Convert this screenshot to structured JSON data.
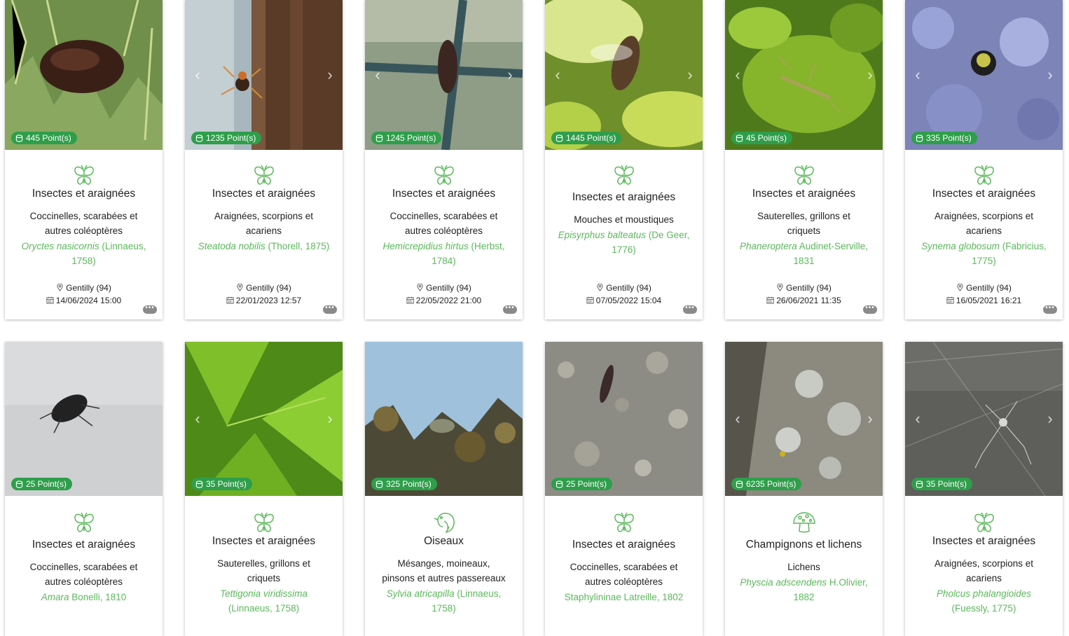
{
  "colors": {
    "accent": "#5cb85c",
    "badge": "#2e9e4a"
  },
  "cards": [
    {
      "points": "445 Point(s)",
      "category": "Insectes et araignées",
      "subcategory": "Coccinelles, scarabées et autres coléoptères",
      "species_latin": "Oryctes nasicornis",
      "species_author": " (Linnaeus, 1758)",
      "location": "Gentilly (94)",
      "date": "14/06/2024 15:00",
      "icon": "butterfly-icon"
    },
    {
      "points": "1235 Point(s)",
      "category": "Insectes et araignées",
      "subcategory": "Araignées, scorpions et acariens",
      "species_latin": "Steatoda nobilis",
      "species_author": " (Thorell, 1875)",
      "location": "Gentilly (94)",
      "date": "22/01/2023 12:57",
      "icon": "butterfly-icon"
    },
    {
      "points": "1245 Point(s)",
      "category": "Insectes et araignées",
      "subcategory": "Coccinelles, scarabées et autres coléoptères",
      "species_latin": "Hemicrepidius hirtus",
      "species_author": " (Herbst, 1784)",
      "location": "Gentilly (94)",
      "date": "22/05/2022 21:00",
      "icon": "butterfly-icon"
    },
    {
      "points": "1445 Point(s)",
      "category": "Insectes et araignées",
      "subcategory": "Mouches et moustiques",
      "species_latin": "Episyrphus balteatus",
      "species_author": " (De Geer, 1776)",
      "location": "Gentilly (94)",
      "date": "07/05/2022 15:04",
      "icon": "butterfly-icon"
    },
    {
      "points": "45 Point(s)",
      "category": "Insectes et araignées",
      "subcategory": "Sauterelles, grillons et criquets",
      "species_latin": "Phaneroptera",
      "species_author": " Audinet-Serville, 1831",
      "location": "Gentilly (94)",
      "date": "26/06/2021 11:35",
      "icon": "butterfly-icon"
    },
    {
      "points": "335 Point(s)",
      "category": "Insectes et araignées",
      "subcategory": "Araignées, scorpions et acariens",
      "species_latin": "Synema globosum",
      "species_author": " (Fabricius, 1775)",
      "location": "Gentilly (94)",
      "date": "16/05/2021 16:21",
      "icon": "butterfly-icon"
    },
    {
      "points": "25 Point(s)",
      "category": "Insectes et araignées",
      "subcategory": "Coccinelles, scarabées et autres coléoptères",
      "species_latin": "Amara",
      "species_author": " Bonelli, 1810",
      "icon": "butterfly-icon"
    },
    {
      "points": "35 Point(s)",
      "category": "Insectes et araignées",
      "subcategory": "Sauterelles, grillons et criquets",
      "species_latin": "Tettigonia viridissima",
      "species_author": " (Linnaeus, 1758)",
      "icon": "butterfly-icon"
    },
    {
      "points": "325 Point(s)",
      "category": "Oiseaux",
      "subcategory": "Mésanges, moineaux, pinsons et autres passereaux",
      "species_latin": "Sylvia atricapilla",
      "species_author": " (Linnaeus, 1758)",
      "icon": "bird-icon"
    },
    {
      "points": "25 Point(s)",
      "category": "Insectes et araignées",
      "subcategory": "Coccinelles, scarabées et autres coléoptères",
      "species_latin": "",
      "species_author": "Staphylininae Latreille, 1802",
      "icon": "butterfly-icon"
    },
    {
      "points": "6235 Point(s)",
      "category": "Champignons et lichens",
      "subcategory": "Lichens",
      "species_latin": "Physcia adscendens",
      "species_author": " H.Olivier, 1882",
      "icon": "mushroom-icon"
    },
    {
      "points": "35 Point(s)",
      "category": "Insectes et araignées",
      "subcategory": "Araignées, scorpions et acariens",
      "species_latin": "Pholcus phalangioides",
      "species_author": " (Fuessly, 1775)",
      "icon": "butterfly-icon"
    }
  ]
}
